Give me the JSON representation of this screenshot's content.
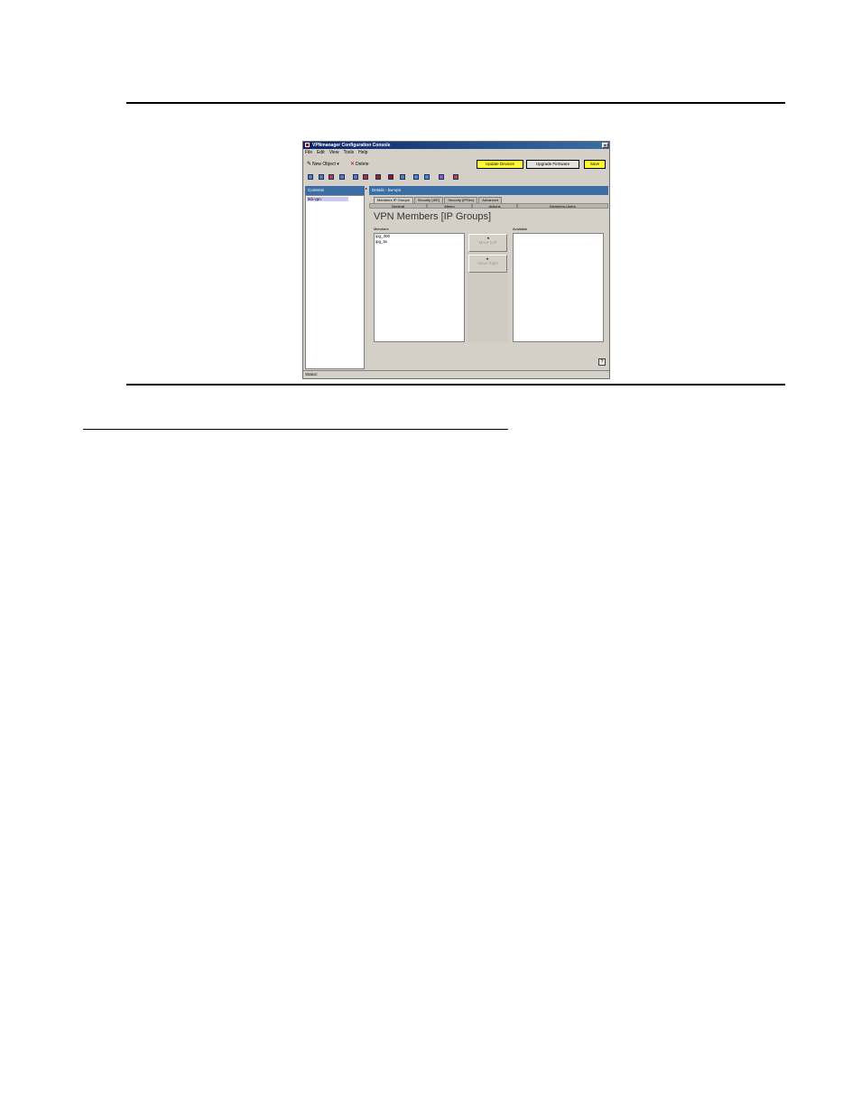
{
  "window": {
    "title": "VPNmanager Configuration Console",
    "close_glyph": "×",
    "menu": [
      "File",
      "Edit",
      "View",
      "Tools",
      "Help"
    ]
  },
  "toolbar": {
    "new_object_label": "New Object",
    "new_object_arrow": "▾",
    "delete_label": "Delete",
    "update_devices_label": "Update Devices",
    "upgrade_firmware_label": "Upgrade Firmware",
    "save_label": "Save"
  },
  "toolbar_icons": [
    "domain-icon",
    "device-icon",
    "ipgroup-icon",
    "user-icon",
    "vpn-icon",
    "security-icon",
    "policy-icon",
    "schedule-icon",
    "log-icon",
    "report-icon",
    "monitor-icon",
    "alarm-icon",
    "tool-icon"
  ],
  "left_pane": {
    "header": "Contents",
    "items": [
      "Ikb-vpn"
    ],
    "splitter_glyph": "▸"
  },
  "right_pane": {
    "header": "Details - bw-vpn",
    "tabs": [
      "Members IP Groups",
      "Security (IKE)",
      "Security (IPSec)",
      "Advanced"
    ],
    "subtabs": [
      "General",
      "Memo",
      "Actions",
      "Members-Users"
    ],
    "page_title": "VPN Members [IP Groups]",
    "members_label": "Members",
    "available_label": "Available",
    "members": [
      "ipg_300",
      "ipg_5x"
    ],
    "move_left_label": "Move Left",
    "move_right_label": "Move Right",
    "move_left_glyph": "◂",
    "move_right_glyph": "▸",
    "help_glyph": "?"
  },
  "status": {
    "label": "Status:"
  },
  "colors": {
    "highlight_button": "#ffff33",
    "header_blue": "#3a6ea5"
  }
}
